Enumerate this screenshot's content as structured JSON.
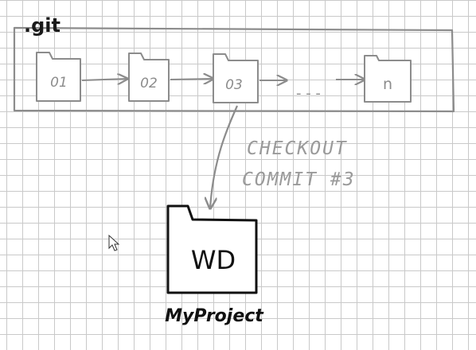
{
  "repo": {
    "label": ".git",
    "commits": [
      "01",
      "02",
      "03",
      "n"
    ],
    "ellipsis": "- - -"
  },
  "annotation": {
    "line1": "CHECKOUT",
    "line2": "COMMIT #3"
  },
  "working_dir": {
    "label": "WD",
    "caption": "MyProject"
  },
  "colors": {
    "sketch_gray": "#8c8c8c",
    "ink_black": "#111111",
    "annotation_gray": "#9a9a9a"
  },
  "icons": {
    "cursor": "mouse-pointer-icon"
  }
}
